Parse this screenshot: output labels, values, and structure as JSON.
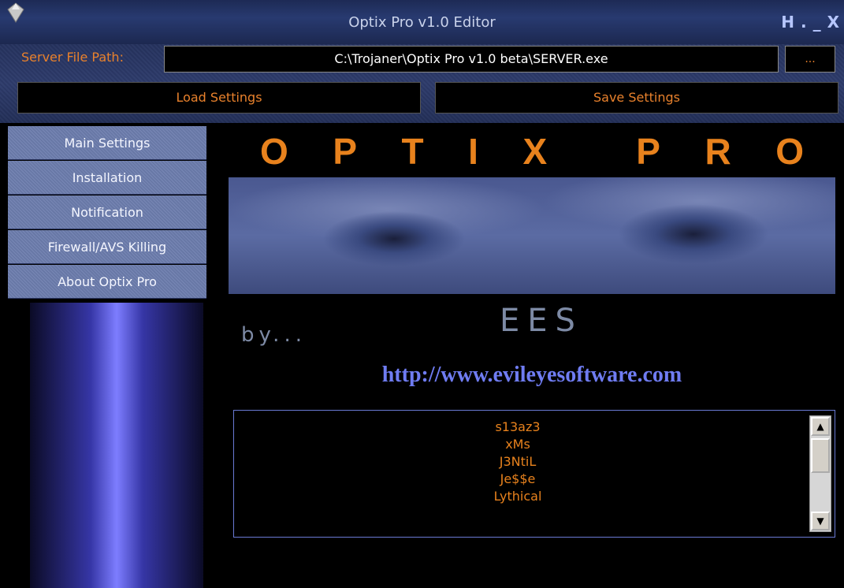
{
  "window": {
    "title": "Optix Pro v1.0 Editor",
    "controls": [
      "H",
      ".",
      "_",
      "X"
    ]
  },
  "server": {
    "label": "Server File Path:",
    "path": "C:\\Trojaner\\Optix Pro v1.0 beta\\SERVER.exe",
    "browse_label": "..."
  },
  "actions": {
    "load_label": "Load Settings",
    "save_label": "Save Settings"
  },
  "sidebar": {
    "items": [
      {
        "label": "Main Settings"
      },
      {
        "label": "Installation"
      },
      {
        "label": "Notification"
      },
      {
        "label": "Firewall/AVS Killing"
      },
      {
        "label": "About Optix Pro"
      }
    ]
  },
  "about": {
    "logo_letters": [
      "O",
      "P",
      "T",
      "I",
      "X",
      "",
      "P",
      "R",
      "O"
    ],
    "by": "by...",
    "author": "EES",
    "url": "http://www.evileyesoftware.com",
    "credits": [
      "s13az3",
      "xMs",
      "J3NtiL",
      "Je$$e",
      "Lythical"
    ]
  },
  "colors": {
    "accent": "#e8812c",
    "link": "#6f7cf2",
    "nav": "#6f7fb0"
  }
}
